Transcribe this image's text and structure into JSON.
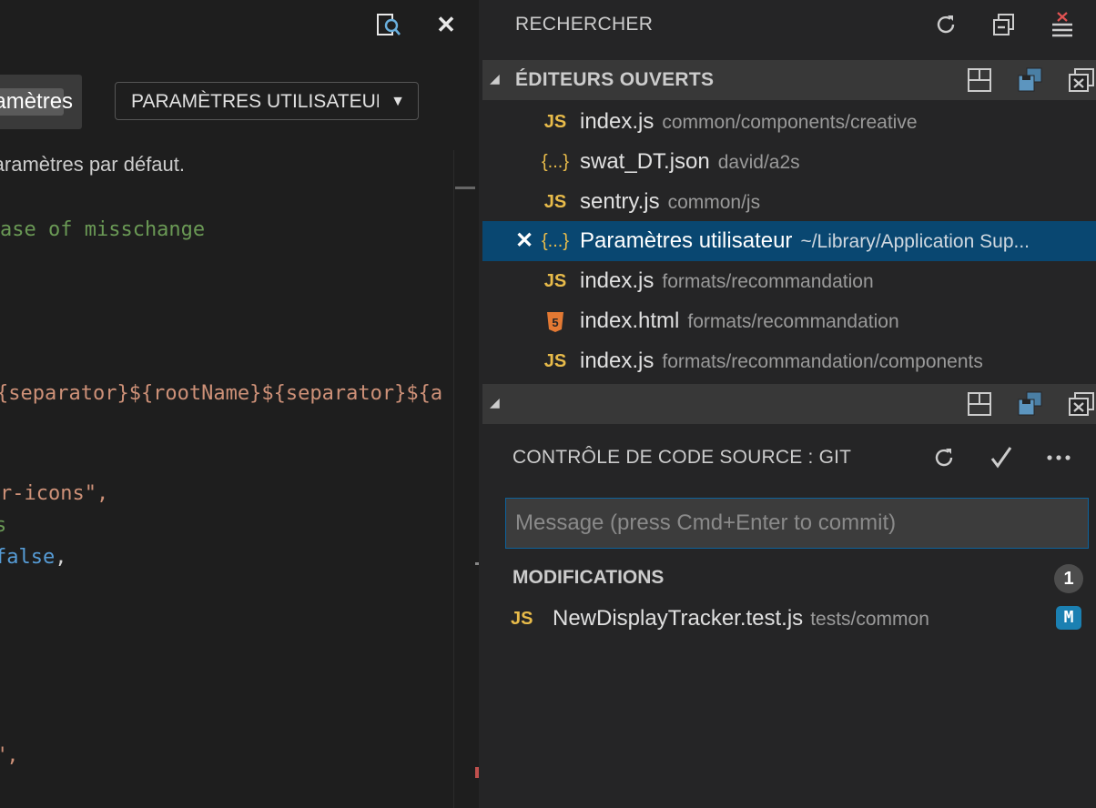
{
  "editor": {
    "settings_tab_label": "Paramètres",
    "scope_select": {
      "selected": "PARAMÈTRES UTILISATEUR"
    },
    "default_note": "Paramètres par défaut.",
    "code_lines": [
      {
        "text": "ase of misschange",
        "kind": "comment"
      },
      {
        "text": "{separator}${rootName}${separator}${a",
        "kind": "string"
      },
      {
        "text": ",",
        "kind": "string"
      },
      {
        "text": "r-icons\",",
        "kind": "string"
      },
      {
        "text": "s",
        "kind": "comment"
      },
      {
        "text": " false",
        "kind": "keyword"
      },
      {
        "text": ",",
        "kind": "punct"
      },
      {
        "text": "\",",
        "kind": "string"
      }
    ]
  },
  "sidebar": {
    "title": "RECHERCHER",
    "open_editors": {
      "title": "ÉDITEURS OUVERTS",
      "items": [
        {
          "icon": "JS",
          "name": "index.js",
          "path": "common/components/creative"
        },
        {
          "icon": "{...}",
          "name": "swat_DT.json",
          "path": "david/a2s"
        },
        {
          "icon": "JS",
          "name": "sentry.js",
          "path": "common/js"
        },
        {
          "icon": "{...}",
          "name": "Paramètres utilisateur",
          "path": "~/Library/Application Sup..."
        },
        {
          "icon": "JS",
          "name": "index.js",
          "path": "formats/recommandation"
        },
        {
          "icon": "5",
          "name": "index.html",
          "path": "formats/recommandation"
        },
        {
          "icon": "JS",
          "name": "index.js",
          "path": "formats/recommandation/components"
        }
      ],
      "close_glyph": "✕"
    },
    "scm": {
      "title": "CONTRÔLE DE CODE SOURCE : GIT",
      "commit_placeholder": "Message (press Cmd+Enter to commit)",
      "changes_title": "MODIFICATIONS",
      "changes_count": "1",
      "change": {
        "icon": "JS",
        "name": "NewDisplayTracker.test.js",
        "path": "tests/common",
        "status": "M"
      }
    }
  },
  "colors": {
    "accent_blue": "#0e639c",
    "selection": "#094771",
    "js_icon": "#e8bb4a",
    "html_icon": "#e37933",
    "modified_badge": "#1b80b2"
  }
}
